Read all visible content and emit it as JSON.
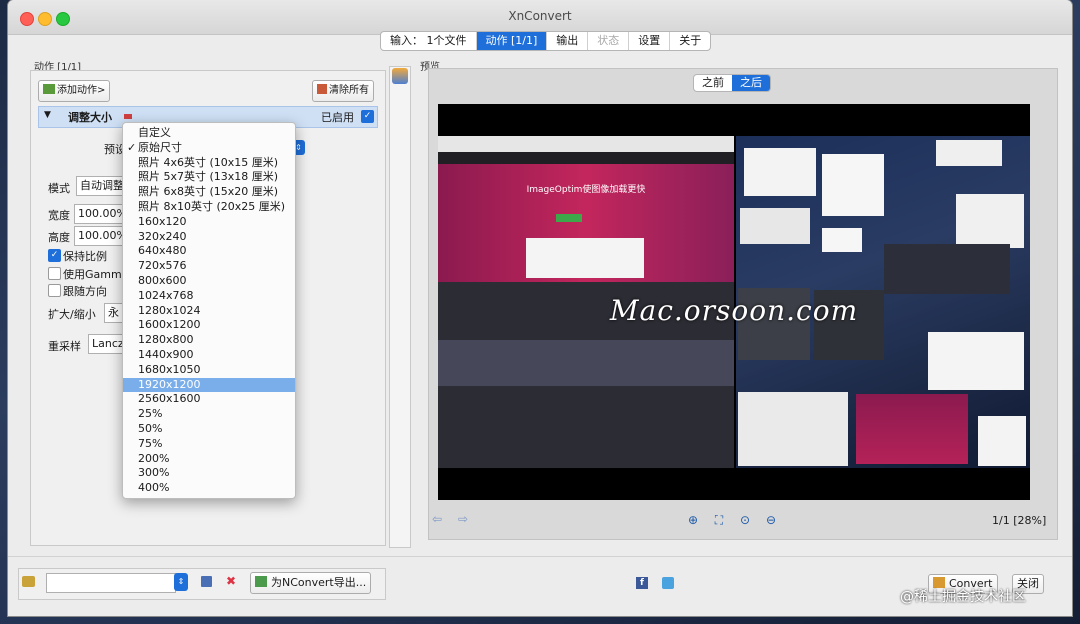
{
  "window": {
    "title": "XnConvert"
  },
  "tabs": [
    {
      "label": "输入： 1个文件",
      "state": "normal"
    },
    {
      "label": "动作 [1/1]",
      "state": "active"
    },
    {
      "label": "输出",
      "state": "normal"
    },
    {
      "label": "状态",
      "state": "disabled"
    },
    {
      "label": "设置",
      "state": "normal"
    },
    {
      "label": "关于",
      "state": "normal"
    }
  ],
  "actions": {
    "header": "动作 [1/1]",
    "add_label": "添加动作>",
    "clear_label": "清除所有",
    "resize_title": "调整大小",
    "enabled_label": "已启用",
    "preset_label": "预设",
    "mode_label": "模式",
    "mode_value": "自动调整",
    "width_label": "宽度",
    "width_value": "100.00%",
    "height_label": "高度",
    "height_value": "100.00%",
    "keep_ratio": "保持比例",
    "use_gamma": "使用Gamma",
    "follow_orient": "跟随方向",
    "enlarge_label": "扩大/缩小",
    "enlarge_value": "永",
    "resample_label": "重采样",
    "resample_value": "Lancz"
  },
  "preset_menu": {
    "items": [
      "自定义",
      "原始尺寸",
      "照片 4x6英寸 (10x15 厘米)",
      "照片 5x7英寸 (13x18 厘米)",
      "照片 6x8英寸 (15x20 厘米)",
      "照片 8x10英寸 (20x25 厘米)",
      "160x120",
      "320x240",
      "640x480",
      "720x576",
      "800x600",
      "1024x768",
      "1280x1024",
      "1600x1200",
      "1280x800",
      "1440x900",
      "1680x1050",
      "1920x1200",
      "2560x1600",
      "25%",
      "50%",
      "75%",
      "200%",
      "300%",
      "400%"
    ],
    "checked_index": 1,
    "highlighted_index": 17
  },
  "preview": {
    "label": "预览",
    "before_label": "之前",
    "after_label": "之后",
    "page_info": "1/1 [28%]"
  },
  "screenshot": {
    "left_headline": "ImageOptim使图像加载更快",
    "watermark": "Mac.orsoon.com"
  },
  "bottom": {
    "export_label": "为NConvert导出...",
    "convert_label": "Convert",
    "close_label": "关闭"
  },
  "corner_watermark": "@稀土掘金技术社区",
  "colors": {
    "accent": "#1e6fd9",
    "highlight": "#7aaeea"
  }
}
